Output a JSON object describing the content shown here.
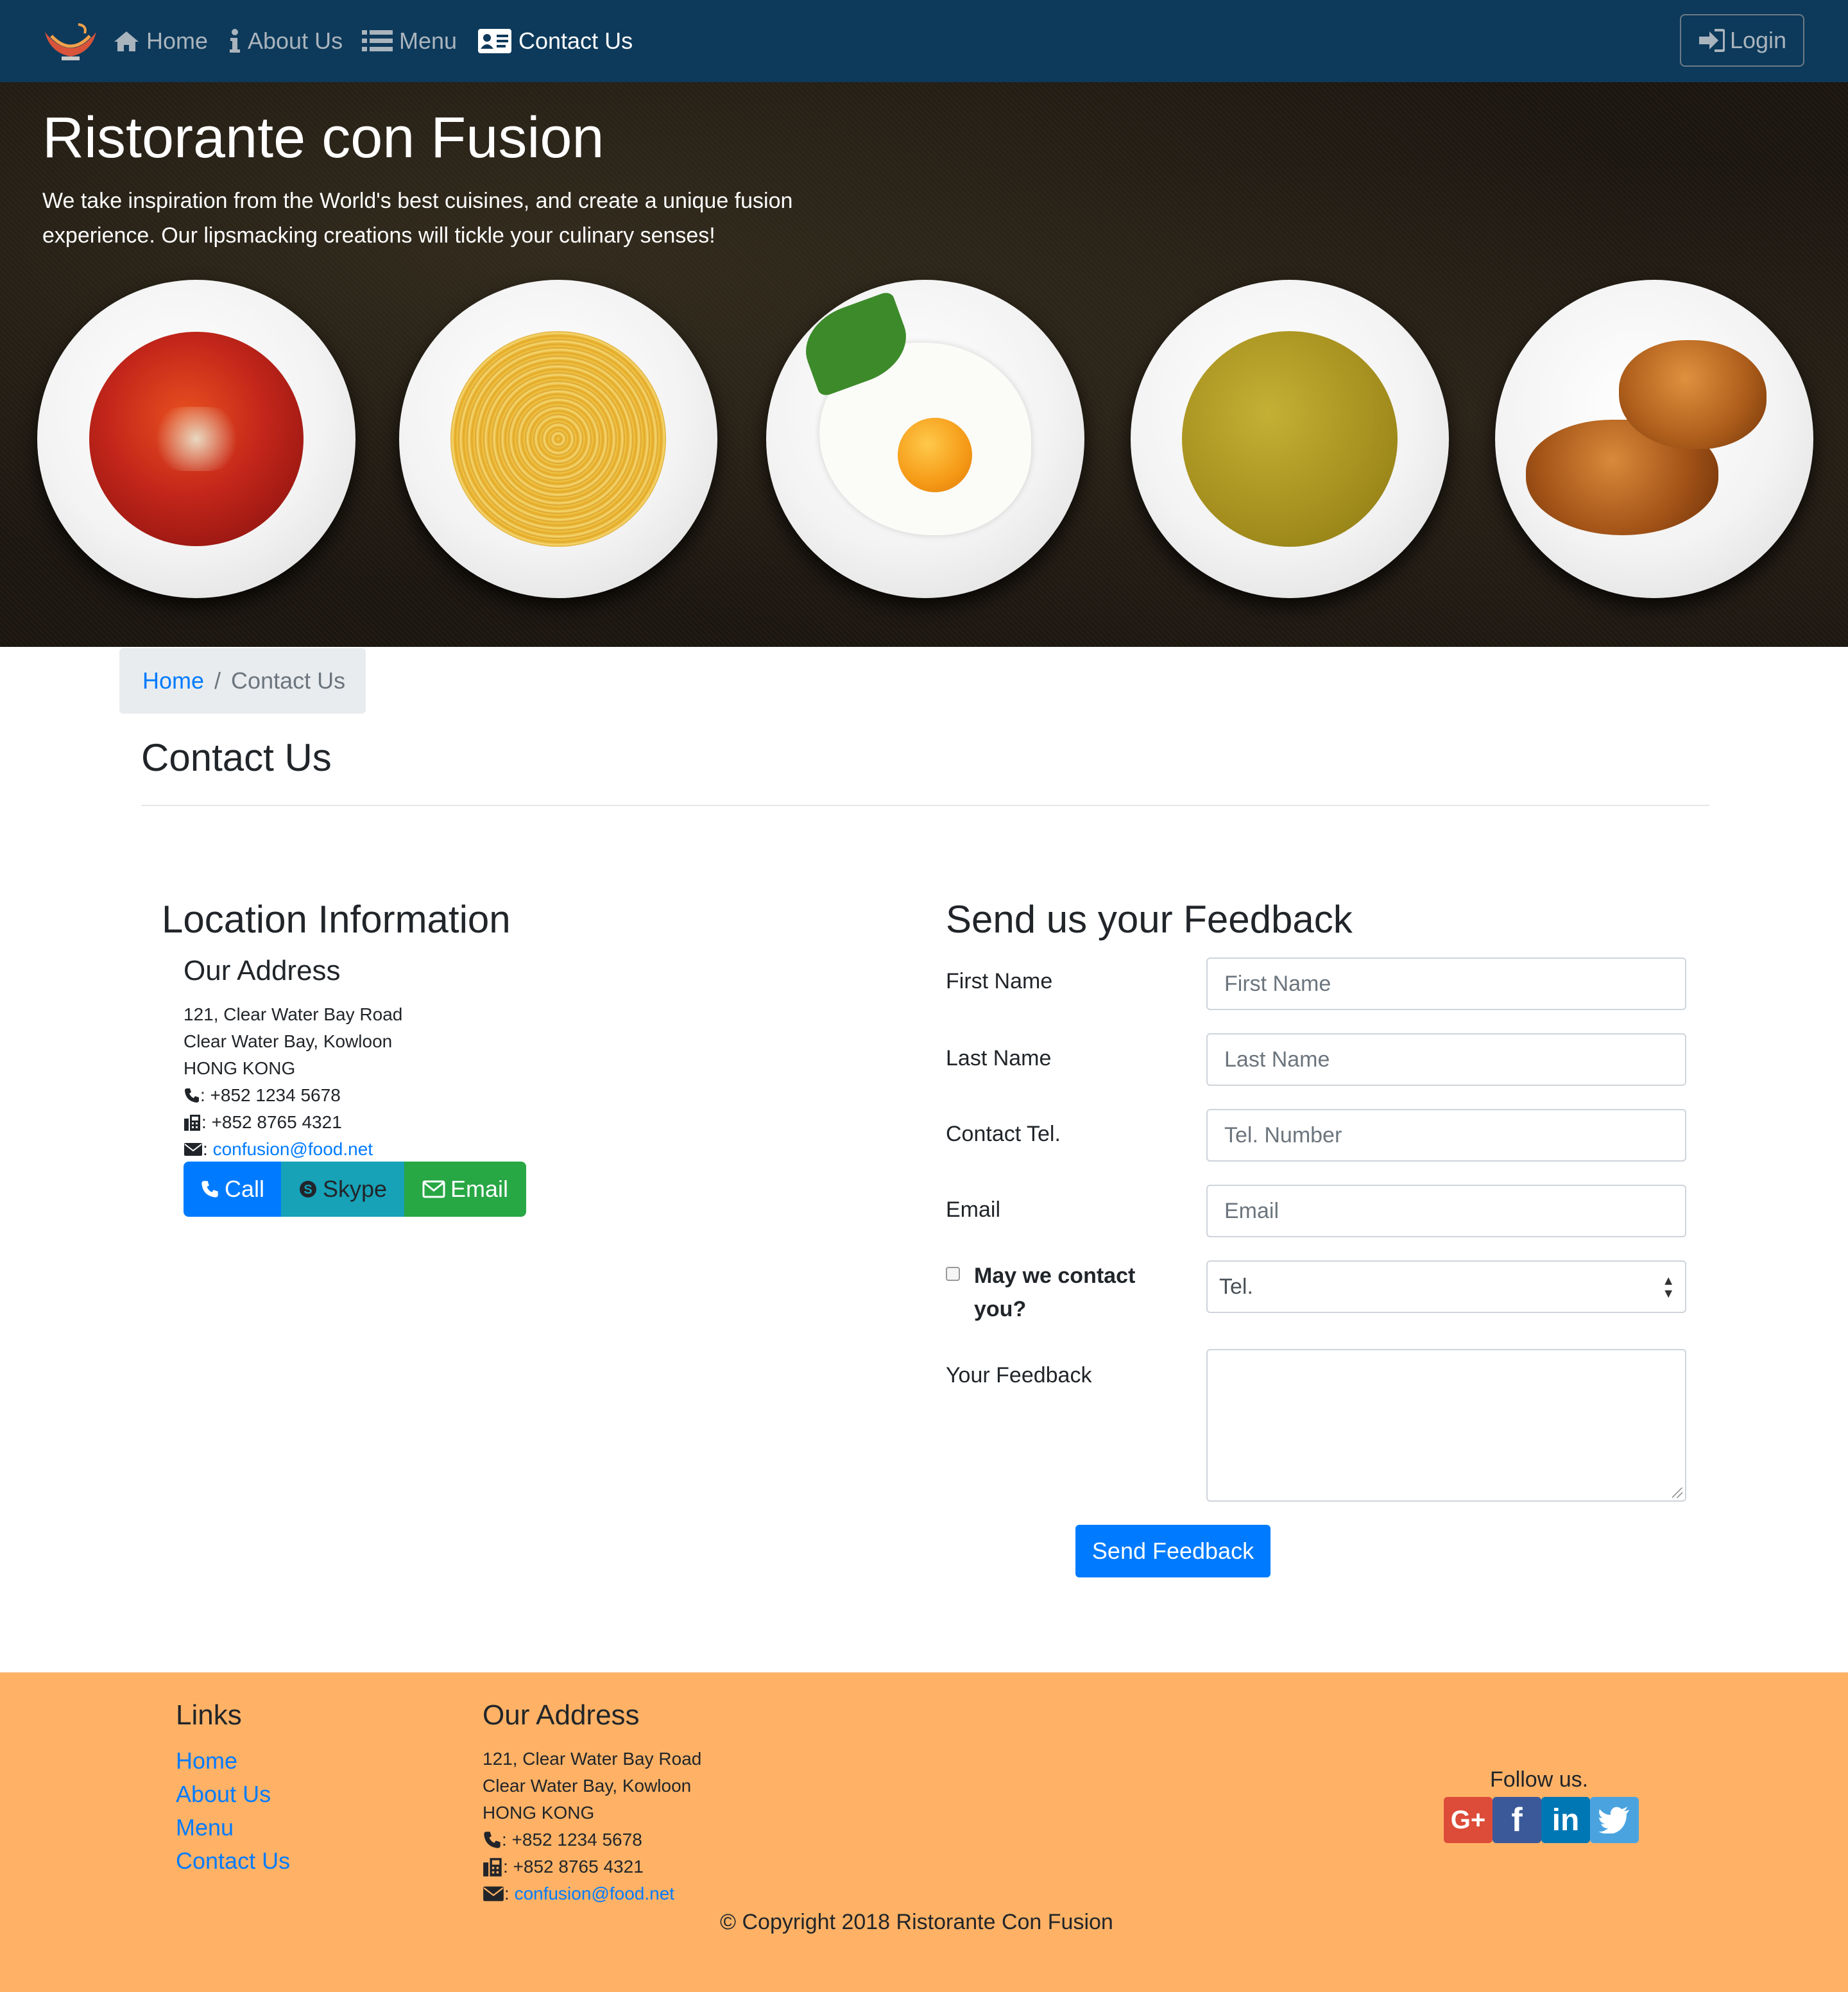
{
  "nav": {
    "items": [
      {
        "label": "Home",
        "icon": "home-icon"
      },
      {
        "label": "About Us",
        "icon": "info-icon"
      },
      {
        "label": "Menu",
        "icon": "list-icon"
      },
      {
        "label": "Contact Us",
        "icon": "address-card-icon"
      }
    ],
    "active": "Contact Us",
    "login_label": "Login"
  },
  "jumbotron": {
    "title": "Ristorante con Fusion",
    "text": "We take inspiration from the World's best cuisines, and create a unique fusion experience. Our lipsmacking creations will tickle your culinary senses!"
  },
  "breadcrumb": {
    "home": "Home",
    "separator": "/",
    "current": "Contact Us"
  },
  "page_title": "Contact Us",
  "location": {
    "title": "Location Information",
    "address_title": "Our Address",
    "address_lines": [
      "121, Clear Water Bay Road",
      "Clear Water Bay, Kowloon",
      "HONG KONG"
    ],
    "phone": ": +852 1234 5678",
    "fax": ": +852 8765 4321",
    "email": "confusion@food.net",
    "buttons": {
      "call": "Call",
      "skype": "Skype",
      "email": "Email"
    }
  },
  "feedback": {
    "title": "Send us your Feedback",
    "first_name_label": "First Name",
    "first_name_placeholder": "First Name",
    "last_name_label": "Last Name",
    "last_name_placeholder": "Last Name",
    "tel_label": "Contact Tel.",
    "tel_placeholder": "Tel. Number",
    "email_label": "Email",
    "email_placeholder": "Email",
    "approve_label": "May we contact you?",
    "contact_type_selected": "Tel.",
    "feedback_label": "Your Feedback",
    "submit_label": "Send Feedback"
  },
  "footer": {
    "links_title": "Links",
    "links": [
      "Home",
      "About Us",
      "Menu",
      "Contact Us"
    ],
    "address_title": "Our Address",
    "address_lines": [
      "121, Clear Water Bay Road",
      "Clear Water Bay, Kowloon",
      "HONG KONG"
    ],
    "phone": ": +852 1234 5678",
    "fax": ": +852 8765 4321",
    "email": "confusion@food.net",
    "follow": "Follow us.",
    "social": [
      "google-plus-icon",
      "facebook-icon",
      "linkedin-icon",
      "twitter-icon"
    ],
    "copyright": "© Copyright 2018 Ristorante Con Fusion"
  },
  "colors": {
    "navbar": "#0d3a5b",
    "primary": "#007bff",
    "info": "#17a2b8",
    "success": "#28a745",
    "footer": "#ffb266"
  }
}
